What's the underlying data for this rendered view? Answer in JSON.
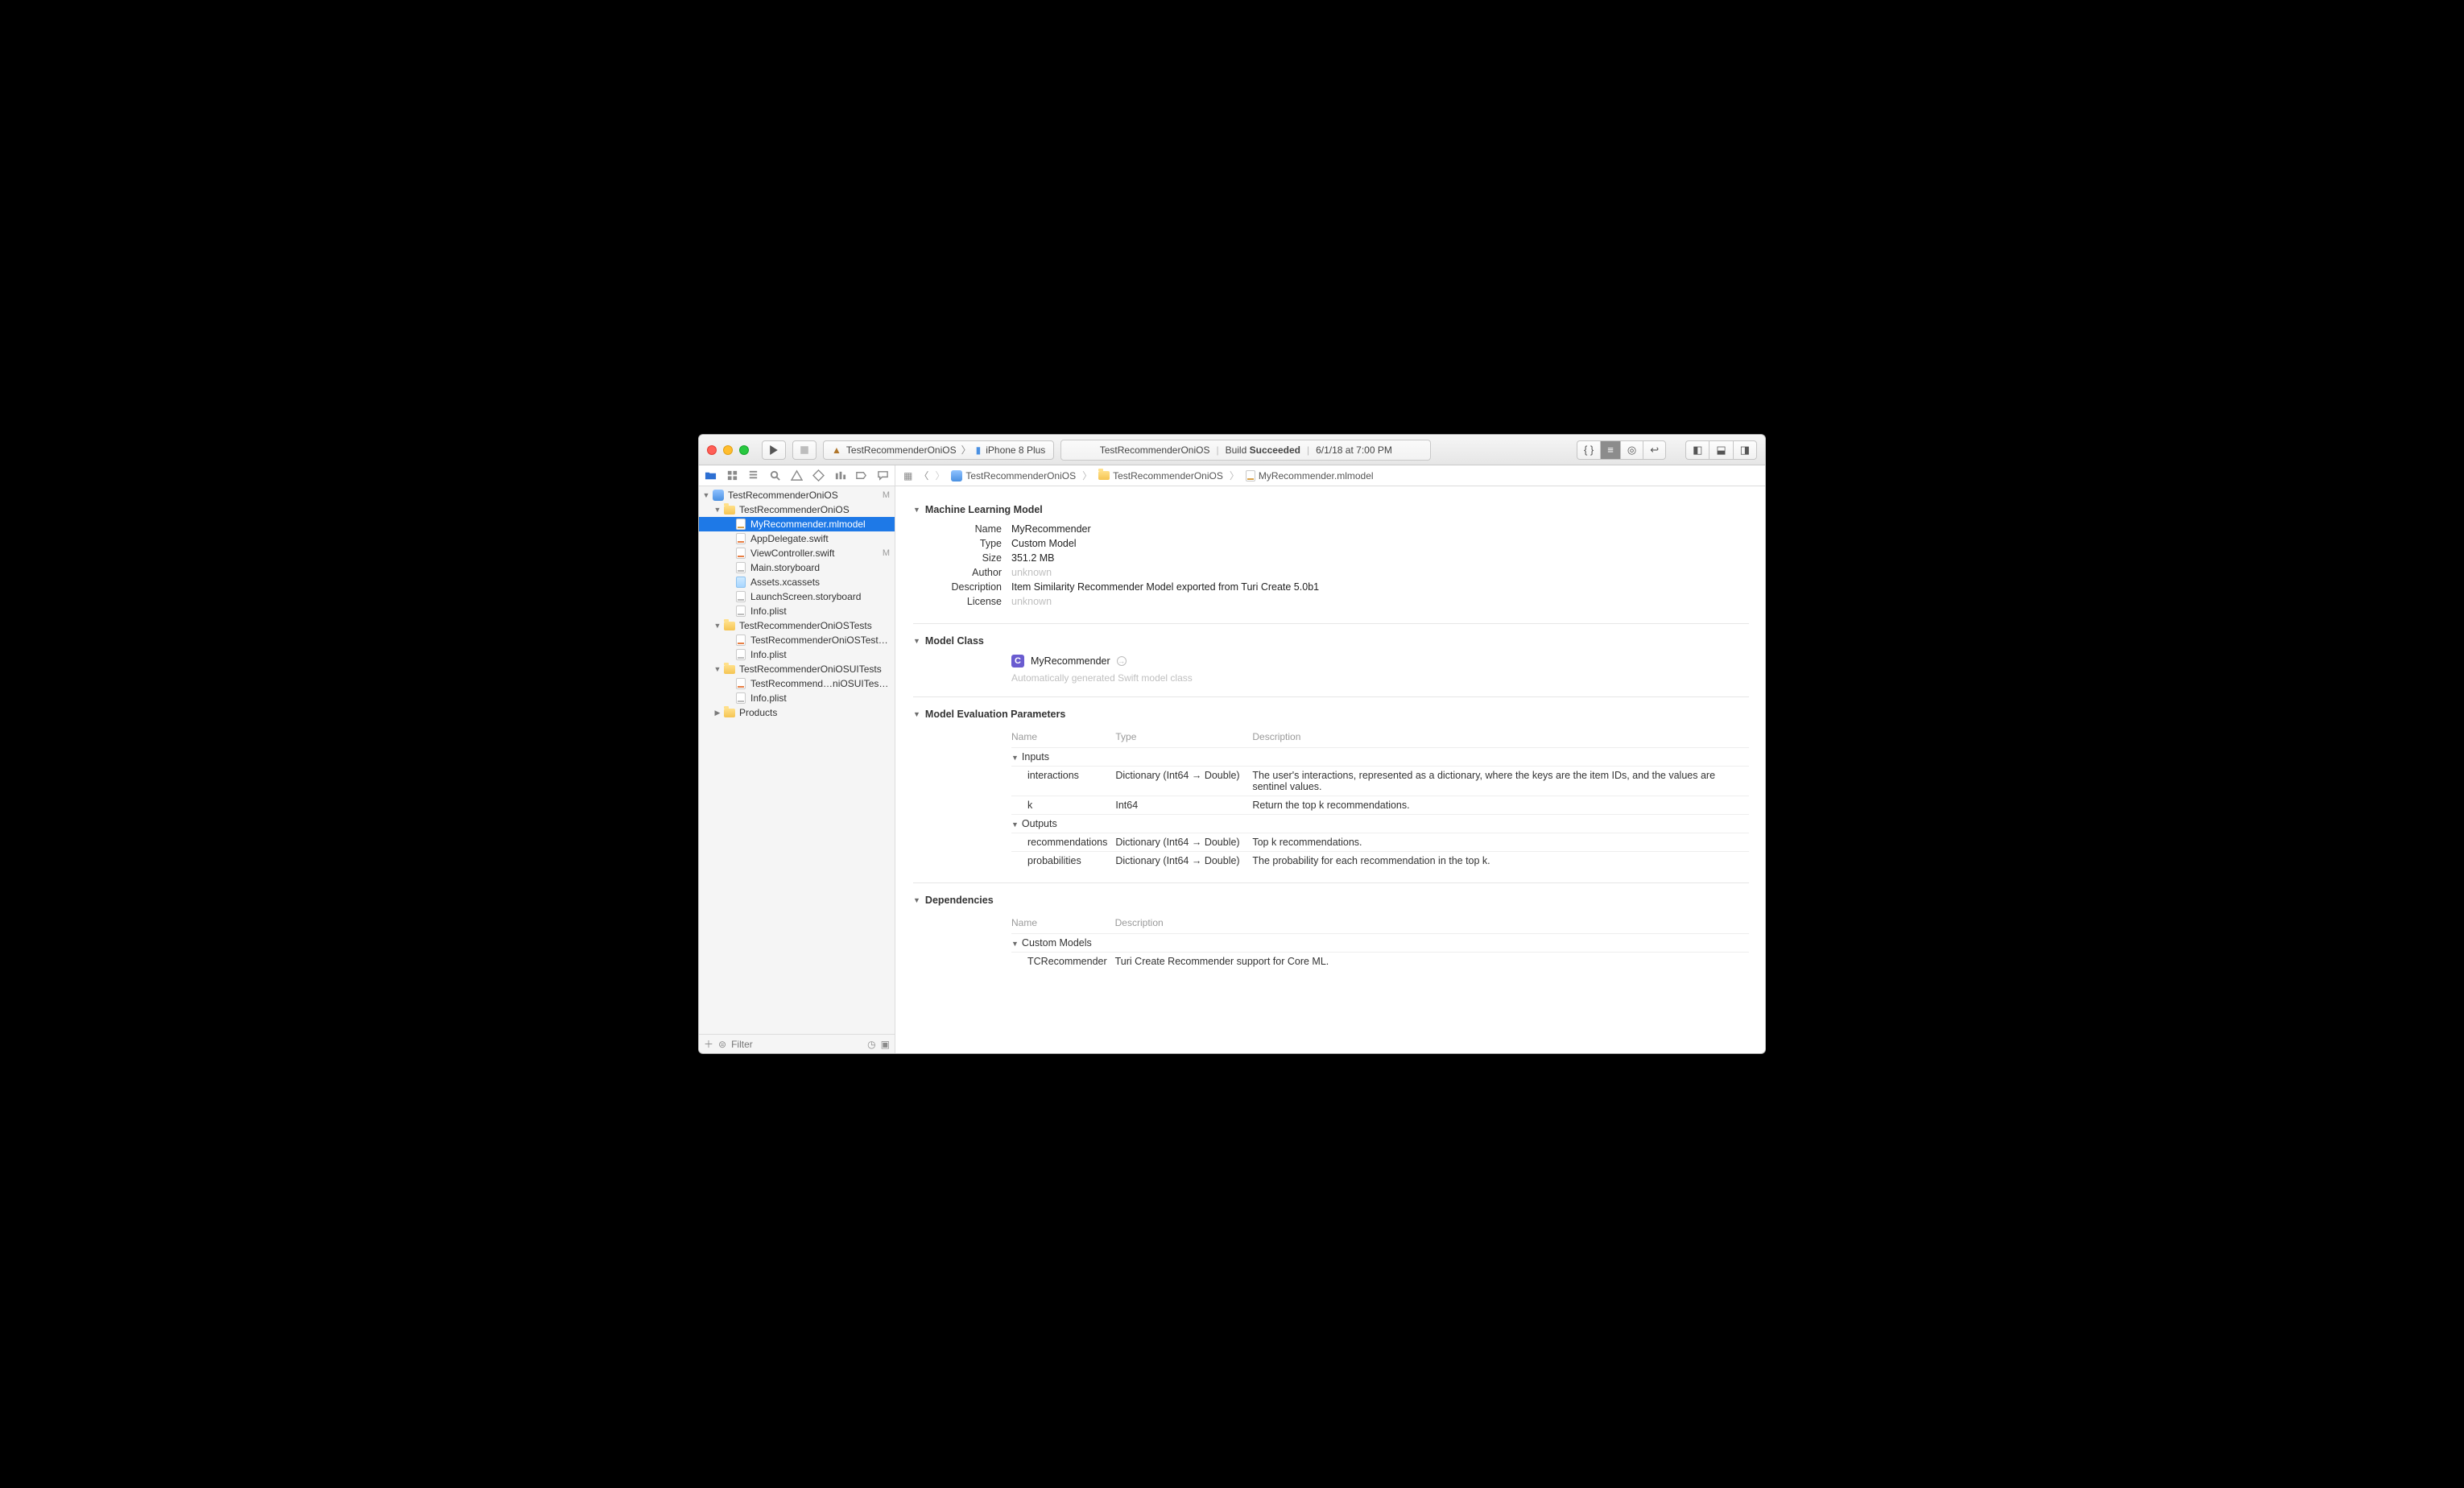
{
  "toolbar": {
    "scheme_target": "TestRecommenderOniOS",
    "scheme_device": "iPhone 8 Plus",
    "status_project": "TestRecommenderOniOS",
    "status_action_prefix": "Build ",
    "status_action_result": "Succeeded",
    "status_time": "6/1/18 at 7:00 PM"
  },
  "breadcrumbs": {
    "a": "TestRecommenderOniOS",
    "b": "TestRecommenderOniOS",
    "c": "MyRecommender.mlmodel"
  },
  "tree": {
    "root": "TestRecommenderOniOS",
    "root_badge": "M",
    "g1": "TestRecommenderOniOS",
    "files1": [
      {
        "n": "MyRecommender.mlmodel",
        "kind": "ml",
        "sel": true
      },
      {
        "n": "AppDelegate.swift",
        "kind": "swift"
      },
      {
        "n": "ViewController.swift",
        "kind": "swift",
        "badge": "M"
      },
      {
        "n": "Main.storyboard",
        "kind": "story"
      },
      {
        "n": "Assets.xcassets",
        "kind": "asset"
      },
      {
        "n": "LaunchScreen.storyboard",
        "kind": "story"
      },
      {
        "n": "Info.plist",
        "kind": "plist"
      }
    ],
    "g2": "TestRecommenderOniOSTests",
    "files2": [
      {
        "n": "TestRecommenderOniOSTests.swift",
        "kind": "swift"
      },
      {
        "n": "Info.plist",
        "kind": "plist"
      }
    ],
    "g3": "TestRecommenderOniOSUITests",
    "files3": [
      {
        "n": "TestRecommend…niOSUITests.swift",
        "kind": "swift"
      },
      {
        "n": "Info.plist",
        "kind": "plist"
      }
    ],
    "products": "Products"
  },
  "filter_placeholder": "Filter",
  "ml": {
    "section1_title": "Machine Learning Model",
    "name_k": "Name",
    "name_v": "MyRecommender",
    "type_k": "Type",
    "type_v": "Custom Model",
    "size_k": "Size",
    "size_v": "351.2 MB",
    "author_k": "Author",
    "author_v": "unknown",
    "desc_k": "Description",
    "desc_v": "Item Similarity Recommender Model exported from Turi Create 5.0b1",
    "license_k": "License",
    "license_v": "unknown",
    "section2_title": "Model Class",
    "class_name": "MyRecommender",
    "class_hint": "Automatically generated Swift model class",
    "section3_title": "Model Evaluation Parameters",
    "col_name": "Name",
    "col_type": "Type",
    "col_desc": "Description",
    "grp_inputs": "Inputs",
    "in1_n": "interactions",
    "in1_t": "Dictionary (Int64 → Double)",
    "in1_d": "The user's interactions, represented as a dictionary, where the keys are the item IDs, and the values are sentinel values.",
    "in2_n": "k",
    "in2_t": "Int64",
    "in2_d": "Return the top k recommendations.",
    "grp_outputs": "Outputs",
    "out1_n": "recommendations",
    "out1_t": "Dictionary (Int64 → Double)",
    "out1_d": "Top k recommendations.",
    "out2_n": "probabilities",
    "out2_t": "Dictionary (Int64 → Double)",
    "out2_d": "The probability for each recommendation in the top k.",
    "section4_title": "Dependencies",
    "dep_col_name": "Name",
    "dep_col_desc": "Description",
    "dep_grp": "Custom Models",
    "dep1_n": "TCRecommender",
    "dep1_d": "Turi Create Recommender support for Core ML."
  }
}
